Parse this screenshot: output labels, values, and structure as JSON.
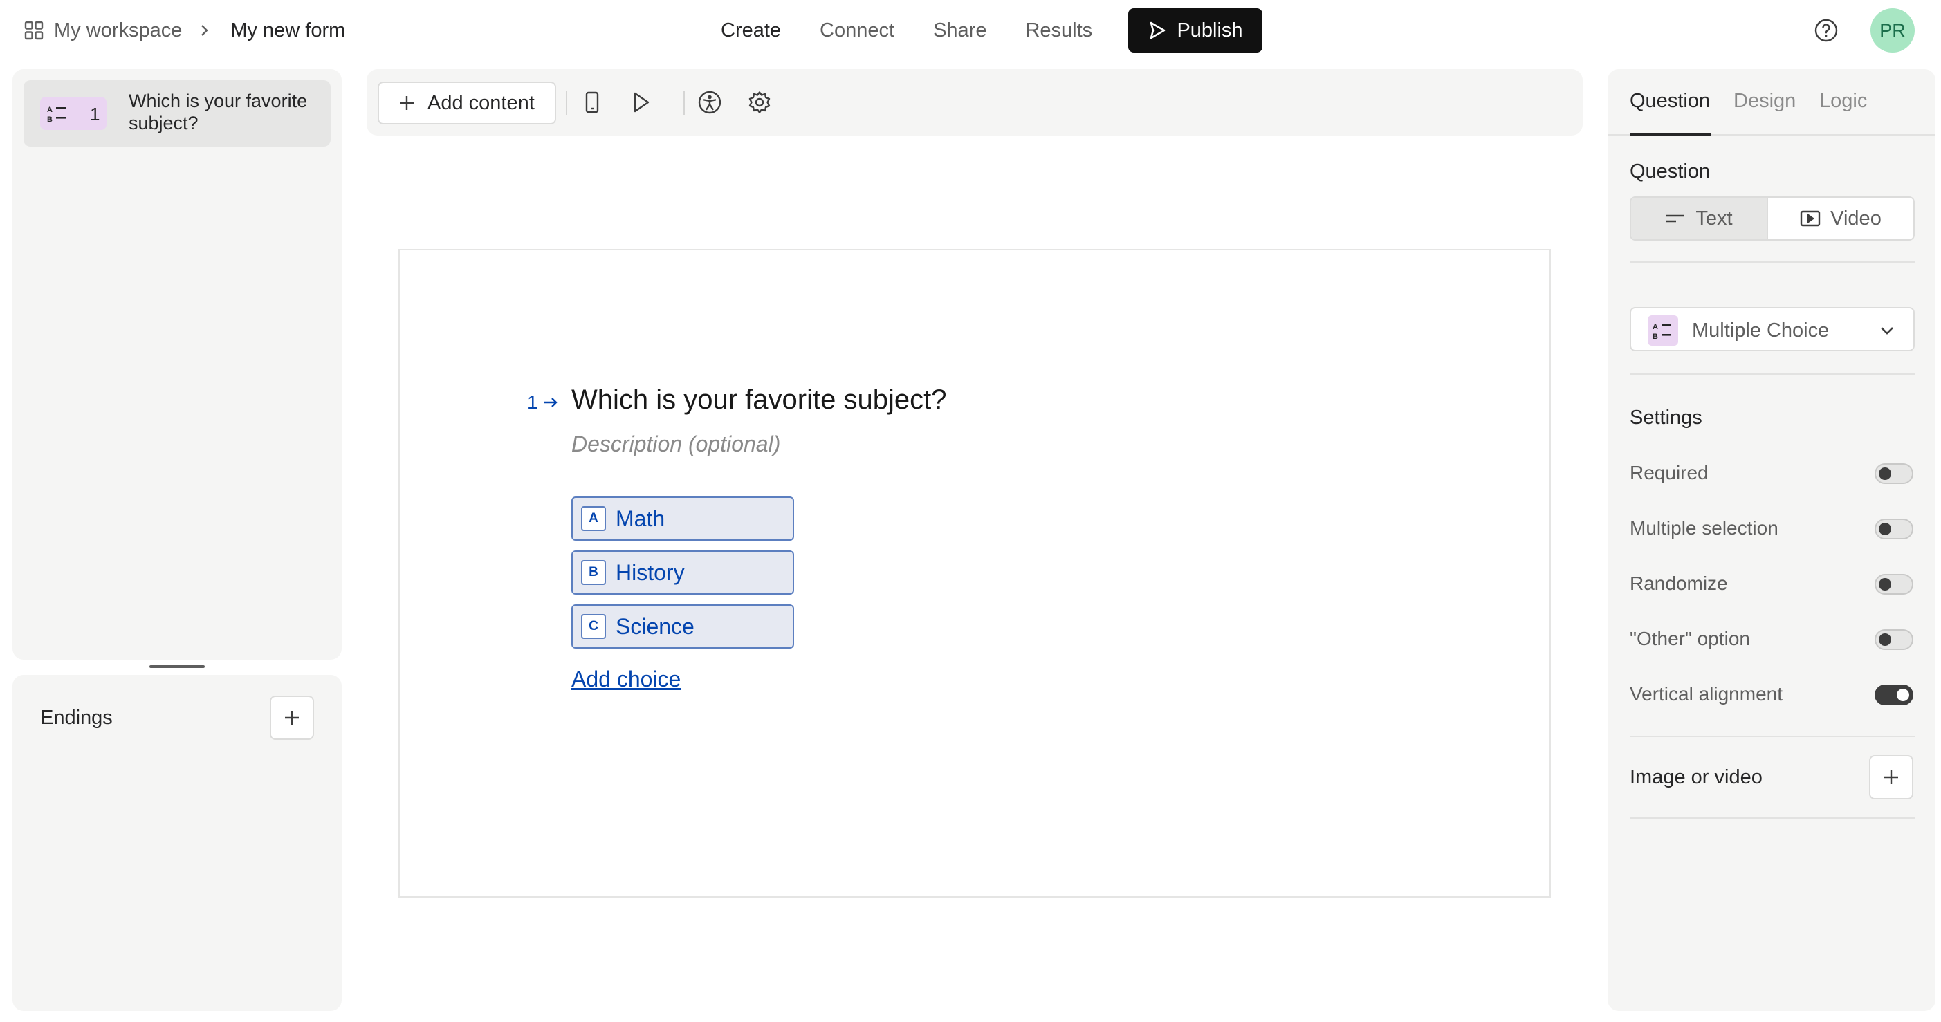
{
  "header": {
    "workspace": "My workspace",
    "form_name": "My new form",
    "nav": [
      "Create",
      "Connect",
      "Share",
      "Results"
    ],
    "active_nav": "Create",
    "publish_label": "Publish",
    "avatar_initials": "PR"
  },
  "sidebar": {
    "questions": [
      {
        "number": "1",
        "title": "Which is your favorite subject?",
        "icon": "multiple-choice-icon"
      }
    ],
    "endings_label": "Endings"
  },
  "toolbar": {
    "add_content_label": "Add content",
    "icons": [
      "mobile-preview-icon",
      "play-preview-icon",
      "accessibility-icon",
      "settings-icon"
    ]
  },
  "canvas": {
    "question_number": "1",
    "question_title": "Which is your favorite subject?",
    "description_placeholder": "Description (optional)",
    "choices": [
      {
        "key": "A",
        "label": "Math"
      },
      {
        "key": "B",
        "label": "History"
      },
      {
        "key": "C",
        "label": "Science"
      }
    ],
    "add_choice_label": "Add choice"
  },
  "panel": {
    "tabs": [
      "Question",
      "Design",
      "Logic"
    ],
    "active_tab": "Question",
    "question_section": "Question",
    "question_modes": [
      "Text",
      "Video"
    ],
    "selected_mode": "Text",
    "question_type": "Multiple Choice",
    "settings_title": "Settings",
    "settings": [
      {
        "label": "Required",
        "on": false
      },
      {
        "label": "Multiple selection",
        "on": false
      },
      {
        "label": "Randomize",
        "on": false
      },
      {
        "label": "\"Other\" option",
        "on": false
      },
      {
        "label": "Vertical alignment",
        "on": true
      }
    ],
    "media_label": "Image or video"
  },
  "colors": {
    "accent": "#0445af",
    "choice_bg": "#e6e9f2",
    "type_badge": "#ead5f2",
    "avatar_bg": "#a8e6c3",
    "publish_bg": "#111111"
  }
}
